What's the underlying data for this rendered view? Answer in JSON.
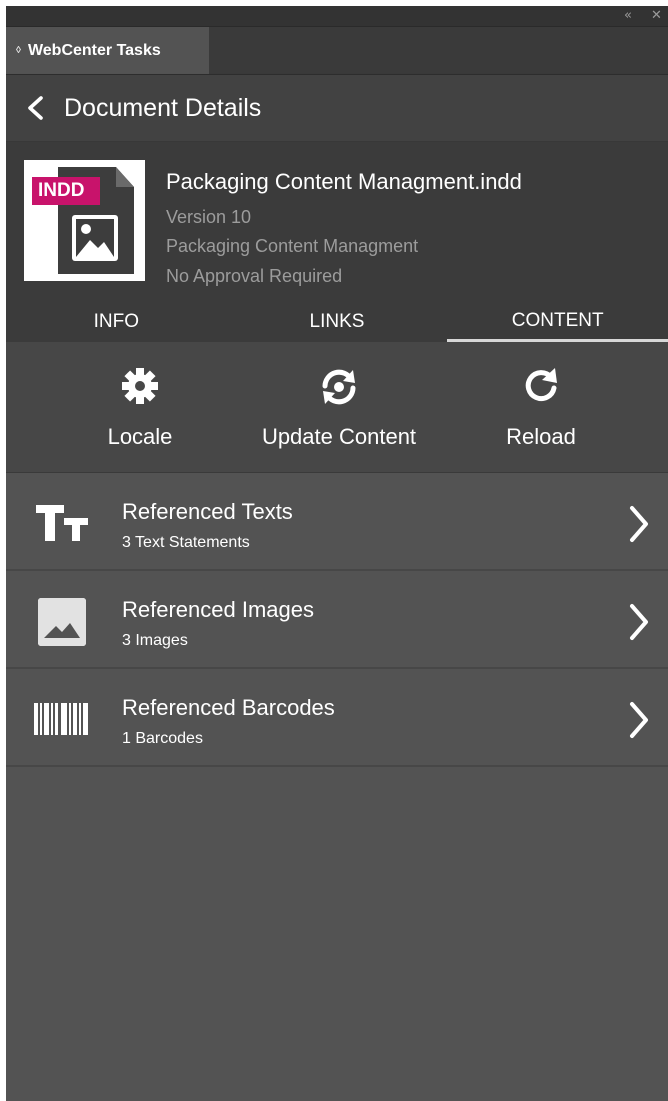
{
  "window": {
    "collapse_glyph": "«",
    "close_glyph": "✕"
  },
  "panel_tab": {
    "grip_glyph": "◊",
    "label": "WebCenter Tasks"
  },
  "header": {
    "title": "Document Details",
    "back_icon": "chevron-left-icon"
  },
  "document": {
    "badge": "INDD",
    "name": "Packaging Content Managment.indd",
    "version": "Version 10",
    "project": "Packaging Content Managment",
    "approval": "No Approval Required"
  },
  "tabs": [
    {
      "label": "INFO",
      "active": false
    },
    {
      "label": "LINKS",
      "active": false
    },
    {
      "label": "CONTENT",
      "active": true
    }
  ],
  "toolbar": {
    "locale": {
      "label": "Locale",
      "icon": "gear-icon"
    },
    "update": {
      "label": "Update Content",
      "icon": "sync-icon"
    },
    "reload": {
      "label": "Reload",
      "icon": "reload-icon"
    }
  },
  "content_items": [
    {
      "title": "Referenced Texts",
      "subtitle": "3 Text Statements",
      "icon": "text-size-icon"
    },
    {
      "title": "Referenced Images",
      "subtitle": "3 Images",
      "icon": "image-icon"
    },
    {
      "title": "Referenced Barcodes",
      "subtitle": "1 Barcodes",
      "icon": "barcode-icon"
    }
  ],
  "colors": {
    "panel_bg": "#535353",
    "header_bg": "#424242",
    "doc_bg": "#3b3b3b",
    "badge": "#c8136b"
  }
}
